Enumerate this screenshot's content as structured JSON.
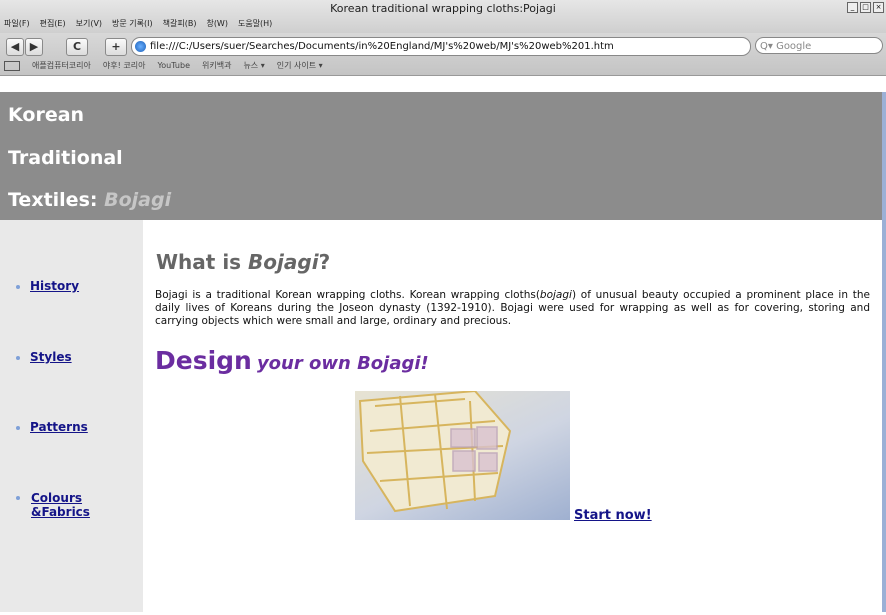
{
  "window": {
    "title": "Korean traditional wrapping cloths:Pojagi",
    "menu": [
      "파일(F)",
      "편집(E)",
      "보기(V)",
      "방문 기록(I)",
      "책갈피(B)",
      "창(W)",
      "도움말(H)"
    ]
  },
  "toolbar": {
    "back_label": "◀",
    "forward_label": "▶",
    "reload_label": "C",
    "add_label": "+",
    "url": "file:///C:/Users/suer/Searches/Documents/in%20England/MJ's%20web/MJ's%20web%201.htm",
    "search_placeholder": "Q▾ Google",
    "bookmarks": [
      "애플컴퓨터코리아",
      "야후! 코리아",
      "YouTube",
      "위키백과",
      "뉴스 ▾",
      "인기 사이트 ▾"
    ]
  },
  "header": {
    "line1": "Korean",
    "line2": "Traditional",
    "line3_prefix": "Textiles:",
    "line3_em": "Bojagi"
  },
  "sidebar": {
    "items": [
      {
        "label": "History"
      },
      {
        "label": "Styles"
      },
      {
        "label": "Patterns"
      },
      {
        "label": "Colours &Fabrics"
      }
    ]
  },
  "main": {
    "heading_prefix": "What is",
    "heading_em": "Bojagi",
    "heading_suffix": "?",
    "body_pre": "Bojagi is a traditional Korean wrapping cloths. Korean wrapping cloths(",
    "body_em": "bojagi",
    "body_post": ") of unusual beauty occupied a prominent place in the daily lives of Koreans during the Joseon dynasty (1392-1910). Bojagi were used for wrapping as well as for covering, storing and carrying objects which were small and large, ordinary and precious.",
    "design_big": "Design",
    "design_small": "your own Bojagi!",
    "start_link": "Start now!"
  },
  "colors": {
    "header_bg": "#8c8c8c",
    "sidebar_bg": "#e9e9e9",
    "link": "#141488",
    "accent_purple": "#6b2da0"
  }
}
